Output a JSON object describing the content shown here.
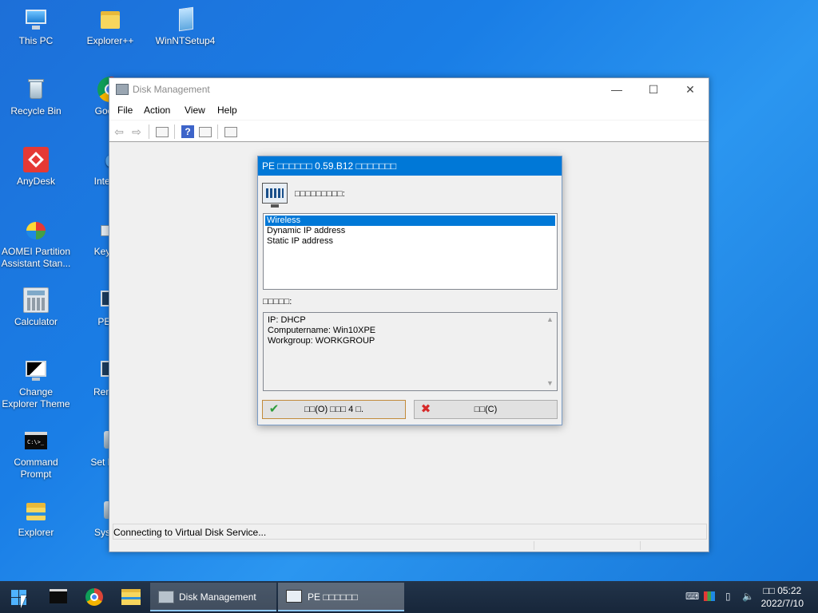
{
  "desktop": {
    "icons": [
      {
        "label": "This PC",
        "icon": "computer-icon"
      },
      {
        "label": "Explorer++",
        "icon": "folder-icon"
      },
      {
        "label": "WinNTSetup4",
        "icon": "setup-icon"
      },
      {
        "label": "Recycle Bin",
        "icon": "recycle-bin-icon"
      },
      {
        "label": "Google",
        "icon": "chrome-icon"
      },
      {
        "label": "AnyDesk",
        "icon": "anydesk-icon"
      },
      {
        "label": "Internet",
        "icon": "internet-explorer-icon"
      },
      {
        "label": "AOMEI Partition Assistant Stan...",
        "icon": "partition-icon"
      },
      {
        "label": "Keyboa",
        "icon": "keyboard-icon"
      },
      {
        "label": "Calculator",
        "icon": "calculator-icon"
      },
      {
        "label": "PENe",
        "icon": "network-icon"
      },
      {
        "label": "Change Explorer Theme",
        "icon": "theme-icon"
      },
      {
        "label": "Remote",
        "icon": "remote-icon"
      },
      {
        "label": "Command Prompt",
        "icon": "cmd-icon"
      },
      {
        "label": "Set Reso",
        "icon": "display-settings-icon"
      },
      {
        "label": "Explorer",
        "icon": "explorer-icon"
      },
      {
        "label": "System",
        "icon": "system-icon"
      }
    ]
  },
  "main_window": {
    "title": "Disk Management",
    "controls": {
      "minimize": "—",
      "maximize": "☐",
      "close": "✕"
    },
    "menu": [
      "File",
      "Action",
      "View",
      "Help"
    ],
    "toolbar_icons": [
      "back-icon",
      "forward-icon",
      "show-hide-console-tree-icon",
      "help-icon",
      "show-hide-action-pane-icon",
      "properties-icon"
    ],
    "status_text": "Connecting to Virtual Disk Service..."
  },
  "dialog": {
    "title": "PE □□□□□□ 0.59.B12 □□□□□□□",
    "prompt_label": "□□□□□□□□□:",
    "list_items": [
      "Wireless",
      "Dynamic IP address",
      "Static IP address"
    ],
    "selected_index": 0,
    "info_label": "□□□□□:",
    "info_lines": [
      "IP: DHCP",
      "Computername: Win10XPE",
      "Workgroup: WORKGROUP"
    ],
    "ok_button": "□□(O) □□□ 4 □.",
    "cancel_button": "□□(C)"
  },
  "taskbar": {
    "pinned": [
      "start-button",
      "cmd-icon",
      "chrome-icon",
      "explorer-icon"
    ],
    "tasks": [
      {
        "label": "Disk Management",
        "active": false
      },
      {
        "label": "PE □□□□□□ 0.59.B12...",
        "active": true
      }
    ],
    "tray_icons": [
      "keyboard-icon",
      "color-icon",
      "usb-icon",
      "volume-muted-icon"
    ],
    "time": "□□ 05:22",
    "date": "2022/7/10"
  },
  "colors": {
    "desktop": "#1a7ee6",
    "title_accent": "#0078d7",
    "taskbar": "#1b2a3a"
  }
}
